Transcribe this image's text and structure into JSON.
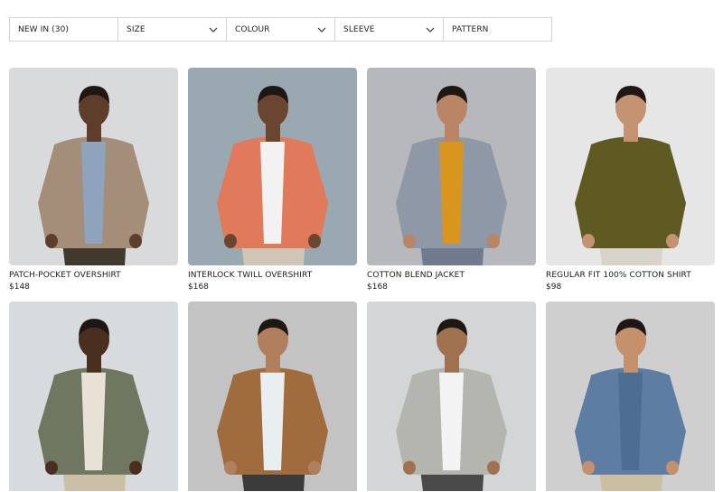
{
  "filters": [
    {
      "label": "NEW IN (30)",
      "has_chevron": false
    },
    {
      "label": "SIZE",
      "has_chevron": true
    },
    {
      "label": "COLOUR",
      "has_chevron": true
    },
    {
      "label": "SLEEVE",
      "has_chevron": true
    },
    {
      "label": "PATTERN",
      "has_chevron": false
    }
  ],
  "products": [
    {
      "name": "PATCH-POCKET OVERSHIRT",
      "price": "$148",
      "bg": "#d9dadc",
      "garment": "#a48e7a",
      "accent": "#8ea4bd",
      "skin": "#5e3d2b",
      "pants": "#3f3a2d"
    },
    {
      "name": "INTERLOCK TWILL OVERSHIRT",
      "price": "$168",
      "bg": "#9aa8b1",
      "garment": "#e07a5a",
      "accent": "#f2f2f2",
      "skin": "#6a4631",
      "pants": "#cfc6b5"
    },
    {
      "name": "COTTON BLEND JACKET",
      "price": "$168",
      "bg": "#b6b8bb",
      "garment": "#8f98a6",
      "accent": "#d9961f",
      "skin": "#b98565",
      "pants": "#6f7a8c"
    },
    {
      "name": "REGULAR FIT 100% COTTON SHIRT",
      "price": "$98",
      "bg": "#e6e6e6",
      "garment": "#5f5a22",
      "accent": "#5f5a22",
      "skin": "#c49472",
      "pants": "#d8d4cc"
    },
    {
      "name": "",
      "price": "",
      "bg": "#d7dbdd",
      "garment": "#6f7760",
      "accent": "#e8e2d6",
      "skin": "#4a2f21",
      "pants": "#cbbfa8"
    },
    {
      "name": "",
      "price": "",
      "bg": "#c3c3c3",
      "garment": "#a06b3d",
      "accent": "#e9eef0",
      "skin": "#b07f5d",
      "pants": "#3b3b3b"
    },
    {
      "name": "",
      "price": "",
      "bg": "#d4d5d6",
      "garment": "#b5b5b0",
      "accent": "#f3f3f3",
      "skin": "#a0714f",
      "pants": "#4a4a4a"
    },
    {
      "name": "",
      "price": "",
      "bg": "#cfcfcf",
      "garment": "#5d7da3",
      "accent": "#4e6d93",
      "skin": "#c4916c",
      "pants": "#cbbfa3"
    }
  ],
  "icons": {
    "chevron": "chevron-down-icon"
  }
}
